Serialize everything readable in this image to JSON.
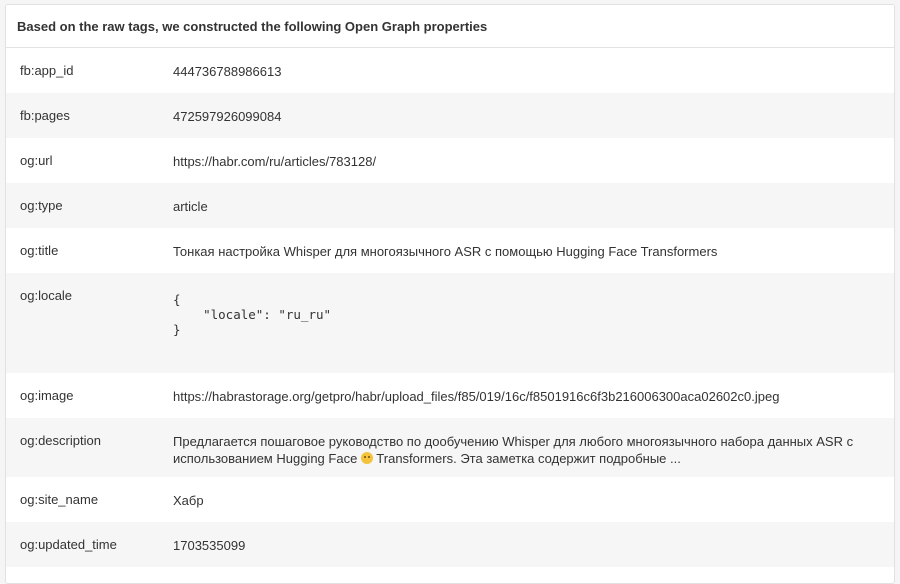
{
  "header": {
    "title": "Based on the raw tags, we constructed the following Open Graph properties"
  },
  "rows": [
    {
      "key": "fb:app_id",
      "value": "444736788986613"
    },
    {
      "key": "fb:pages",
      "value": "472597926099084"
    },
    {
      "key": "og:url",
      "value": "https://habr.com/ru/articles/783128/"
    },
    {
      "key": "og:type",
      "value": "article"
    },
    {
      "key": "og:title",
      "value": "Тонкая настройка Whisper для многоязычного ASR с помощью Hugging Face Transformers"
    },
    {
      "key": "og:locale",
      "value": "{\n    \"locale\": \"ru_ru\"\n}"
    },
    {
      "key": "og:image",
      "value": "https://habrastorage.org/getpro/habr/upload_files/f85/019/16c/f8501916c6f3b216006300aca02602c0.jpeg"
    },
    {
      "key": "og:description",
      "value_before_emoji": "Предлагается пошаговое руководство по дообучению Whisper для любого многоязычного набора данных ASR с использованием Hugging Face ",
      "emoji_icon": "hugging-face-emoji-icon",
      "value_after_emoji": " Transformers. Эта заметка содержит подробные ..."
    },
    {
      "key": "og:site_name",
      "value": "Хабр"
    },
    {
      "key": "og:updated_time",
      "value": "1703535099"
    }
  ]
}
